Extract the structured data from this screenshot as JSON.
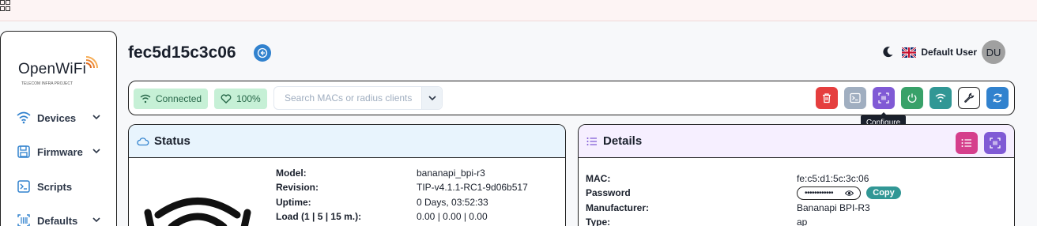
{
  "colors": {
    "accent_blue": "#3182ce",
    "delete_red": "#e53e3e",
    "terminal_gray": "#a0aec0",
    "configure_purple": "#805ad5",
    "reboot_green": "#38a169",
    "wifi_teal": "#319795",
    "refresh_blue": "#3182ce",
    "connected_badge": "#c6f0d6",
    "list_pink": "#d53f8c"
  },
  "sidebar": {
    "logo_text": "OpenWiFi",
    "logo_sub": "TELECOM INFRA PROJECT",
    "items": [
      {
        "label": "Devices",
        "icon": "wifi-icon",
        "has_chevron": true
      },
      {
        "label": "Firmware",
        "icon": "floppy-icon",
        "has_chevron": true
      },
      {
        "label": "Scripts",
        "icon": "terminal-icon",
        "has_chevron": false
      },
      {
        "label": "Defaults",
        "icon": "barcode-icon",
        "has_chevron": true
      }
    ]
  },
  "header": {
    "device_id": "fec5d15c3c06",
    "user_name": "Default User",
    "avatar_initials": "DU"
  },
  "toolbar": {
    "connected_label": "Connected",
    "health_label": "100%",
    "search_placeholder": "Search MACs or radius clients",
    "buttons": [
      "delete",
      "terminal",
      "configure",
      "reboot",
      "wifi-scan",
      "tools",
      "refresh"
    ],
    "tooltip": "Configure"
  },
  "status": {
    "title": "Status",
    "rows": [
      {
        "label": "Model:",
        "value": "bananapi_bpi-r3"
      },
      {
        "label": "Revision:",
        "value": "TIP-v4.1.1-RC1-9d06b517"
      },
      {
        "label": "Uptime:",
        "value": "0 Days, 03:52:33"
      },
      {
        "label": "Load (1 | 5 | 15 m.):",
        "value": "0.00 | 0.00 | 0.00"
      }
    ]
  },
  "details": {
    "title": "Details",
    "mac_label": "MAC:",
    "mac_value": "fe:c5:d1:5c:3c:06",
    "password_label": "Password",
    "password_masked": "••••••••••••",
    "copy_label": "Copy",
    "manufacturer_label": "Manufacturer:",
    "manufacturer_value": "Bananapi BPI-R3",
    "type_label": "Type:",
    "type_value": "ap"
  }
}
